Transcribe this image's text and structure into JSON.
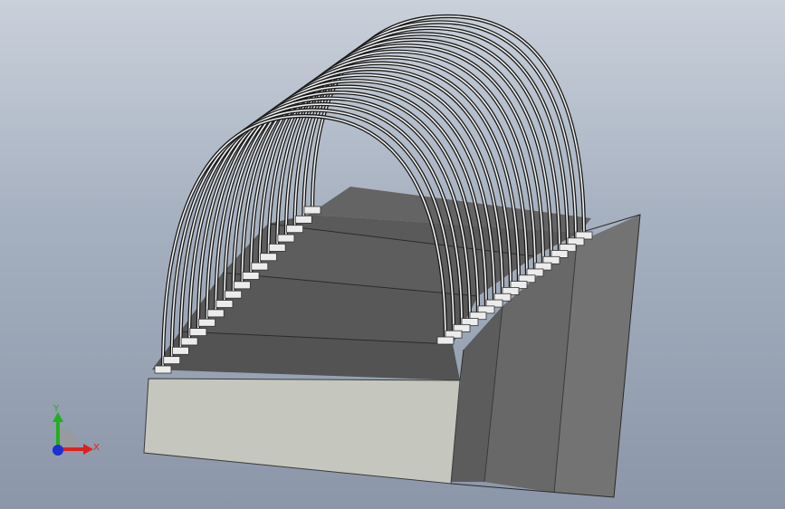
{
  "viewport": {
    "background_top": "#c9d0da",
    "background_bottom": "#8b96a8"
  },
  "model": {
    "type": "arched-frame-greenhouse",
    "arch_count": 18,
    "base_step_count": 3,
    "colors": {
      "front_wall": "#c5c6bd",
      "step_top": "#5f5f5f",
      "step_riser": "#505050",
      "side_wall": "#6e6e6e",
      "arch_tube": "#f2f2f2",
      "arch_outline": "#1a1a1a",
      "footing": "#ececec"
    }
  },
  "triad": {
    "x_label": "X",
    "y_label": "Y",
    "x_color": "#e0201b",
    "y_color": "#1fb024",
    "z_color": "#1c2fd1"
  }
}
